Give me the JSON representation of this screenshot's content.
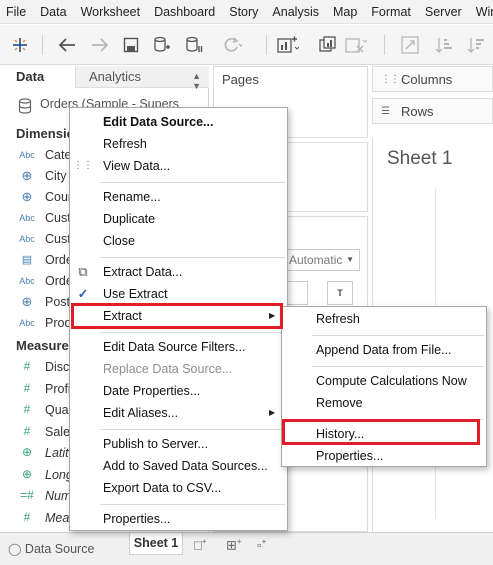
{
  "menubar": [
    "File",
    "Data",
    "Worksheet",
    "Dashboard",
    "Story",
    "Analysis",
    "Map",
    "Format",
    "Server",
    "Wind"
  ],
  "left_pane": {
    "data_tab": "Data",
    "analytics_tab": "Analytics",
    "data_source": "Orders (Sample - Supers",
    "dimensions_header": "Dimensions",
    "dimensions": [
      {
        "type": "Abc",
        "name": "Category",
        "icon": "abc-icon"
      },
      {
        "type": "globe",
        "name": "City",
        "icon": "globe-icon"
      },
      {
        "type": "globe",
        "name": "Country",
        "icon": "globe-icon"
      },
      {
        "type": "Abc",
        "name": "Customer ID",
        "icon": "abc-icon"
      },
      {
        "type": "Abc",
        "name": "Customer Name",
        "icon": "abc-icon"
      },
      {
        "type": "date",
        "name": "Order Date",
        "icon": "calendar-icon"
      },
      {
        "type": "Abc",
        "name": "Order ID",
        "icon": "abc-icon"
      },
      {
        "type": "globe",
        "name": "Postal Code",
        "icon": "globe-icon"
      },
      {
        "type": "Abc",
        "name": "Product ID",
        "icon": "abc-icon"
      }
    ],
    "measures_header": "Measures",
    "measures": [
      {
        "type": "#",
        "name": "Discount",
        "italic": false
      },
      {
        "type": "#",
        "name": "Profit",
        "italic": false
      },
      {
        "type": "#",
        "name": "Quantity",
        "italic": false
      },
      {
        "type": "#",
        "name": "Sales",
        "italic": false
      },
      {
        "type": "globe",
        "name": "Latitude (generated)",
        "italic": true
      },
      {
        "type": "globe",
        "name": "Longitude (generated)",
        "italic": true
      },
      {
        "type": "=#",
        "name": "Number of Records",
        "italic": true
      },
      {
        "type": "#",
        "name": "Measure Values",
        "italic": true
      }
    ]
  },
  "middle": {
    "pages_label": "Pages",
    "marks_type": "Automatic"
  },
  "right": {
    "columns_label": "Columns",
    "rows_label": "Rows",
    "sheet_title": "Sheet 1"
  },
  "statusbar": {
    "data_source_tab": "Data Source",
    "sheet_tab": "Sheet 1"
  },
  "context_menu": [
    {
      "label": "Edit Data Source...",
      "bold": true
    },
    {
      "label": "Refresh"
    },
    {
      "label": "View Data...",
      "icon": "grid-icon"
    },
    {
      "divider": true
    },
    {
      "label": "Rename..."
    },
    {
      "label": "Duplicate"
    },
    {
      "label": "Close"
    },
    {
      "divider": true
    },
    {
      "label": "Extract Data...",
      "icon": "extract-icon"
    },
    {
      "label": "Use Extract",
      "checked": true
    },
    {
      "label": "Extract",
      "submenu": true,
      "highlighted": true
    },
    {
      "divider": true
    },
    {
      "label": "Edit Data Source Filters..."
    },
    {
      "label": "Replace Data Source...",
      "disabled": true
    },
    {
      "label": "Date Properties..."
    },
    {
      "label": "Edit Aliases...",
      "submenu": true
    },
    {
      "divider": true
    },
    {
      "label": "Publish to Server..."
    },
    {
      "label": "Add to Saved Data Sources..."
    },
    {
      "label": "Export Data to CSV..."
    },
    {
      "divider": true
    },
    {
      "label": "Properties..."
    }
  ],
  "extract_submenu": [
    {
      "label": "Refresh"
    },
    {
      "divider": true
    },
    {
      "label": "Append Data from File..."
    },
    {
      "divider": true
    },
    {
      "label": "Compute Calculations Now"
    },
    {
      "label": "Remove"
    },
    {
      "divider": true
    },
    {
      "label": "History...",
      "highlighted": true
    },
    {
      "label": "Properties..."
    }
  ],
  "colors": {
    "highlight_border": "#e01e2a",
    "dimension_icon": "#4a7fb5",
    "measure_icon": "#3aa37a"
  }
}
